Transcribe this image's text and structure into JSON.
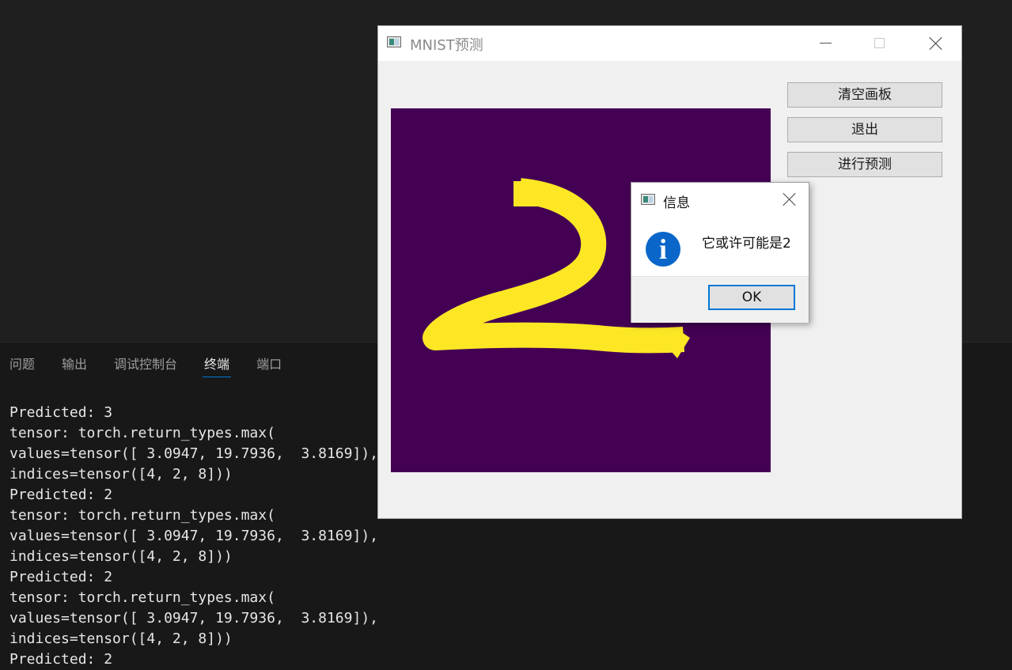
{
  "panel": {
    "tabs": [
      {
        "label": "问题"
      },
      {
        "label": "输出"
      },
      {
        "label": "调试控制台"
      },
      {
        "label": "终端",
        "active": true
      },
      {
        "label": "端口"
      }
    ],
    "terminal_lines": [
      "Predicted: 3",
      "tensor: torch.return_types.max(",
      "values=tensor([ 3.0947, 19.7936,  3.8169]),",
      "indices=tensor([4, 2, 8]))",
      "Predicted: 2",
      "tensor: torch.return_types.max(",
      "values=tensor([ 3.0947, 19.7936,  3.8169]),",
      "indices=tensor([4, 2, 8]))",
      "Predicted: 2",
      "tensor: torch.return_types.max(",
      "values=tensor([ 3.0947, 19.7936,  3.8169]),",
      "indices=tensor([4, 2, 8]))",
      "Predicted: 2"
    ]
  },
  "window": {
    "title": "MNIST预测",
    "buttons": {
      "clear": "清空画板",
      "exit": "退出",
      "predict": "进行预测"
    },
    "canvas": {
      "background": "#440154",
      "stroke_color": "#fde725",
      "drawn_digit": "2"
    }
  },
  "dialog": {
    "title": "信息",
    "message": "它或许可能是2",
    "ok_label": "OK",
    "icon": "info-icon"
  },
  "colors": {
    "accent": "#0078d4",
    "terminal_bg": "#181818",
    "window_bg": "#f0f0f0"
  }
}
